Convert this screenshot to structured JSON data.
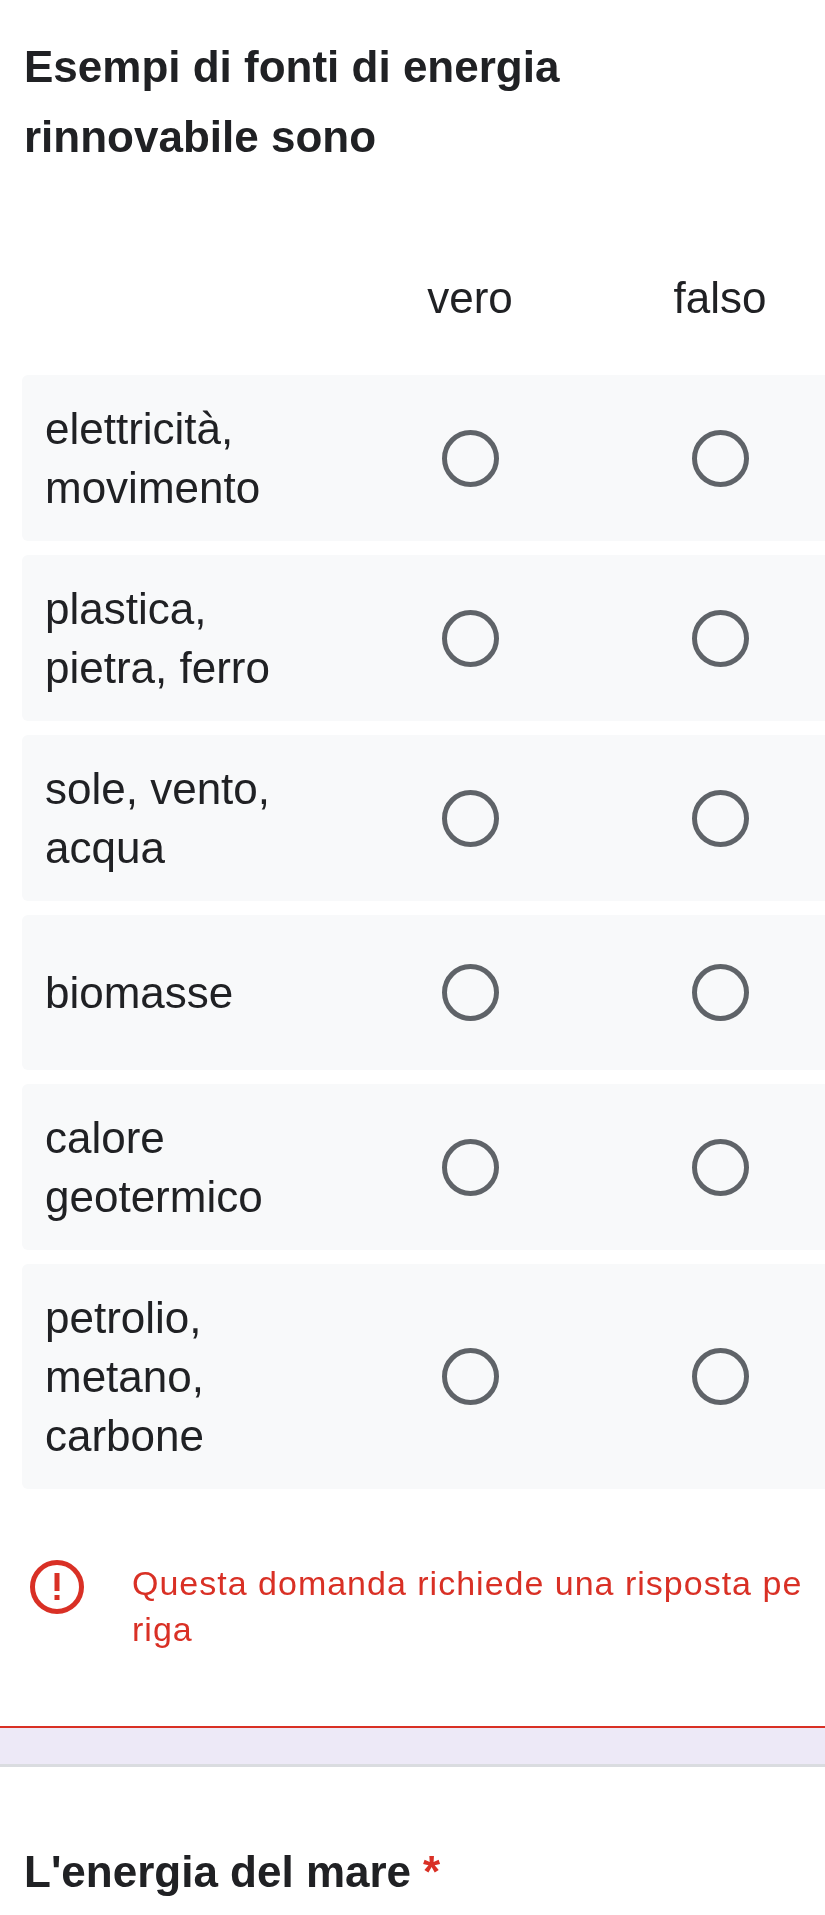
{
  "question": {
    "title": "Esempi di fonti di energia rinnovabile sono",
    "columns": [
      "vero",
      "falso"
    ],
    "rows": [
      {
        "label": "elettricità, movimento",
        "choices": [
          {
            "selected": false
          },
          {
            "selected": false
          }
        ]
      },
      {
        "label": "plastica, pietra, ferro",
        "choices": [
          {
            "selected": false
          },
          {
            "selected": false
          }
        ]
      },
      {
        "label": "sole, vento, acqua",
        "choices": [
          {
            "selected": false
          },
          {
            "selected": false
          }
        ]
      },
      {
        "label": "biomasse",
        "choices": [
          {
            "selected": false
          },
          {
            "selected": false
          }
        ]
      },
      {
        "label": "calore geotermico",
        "choices": [
          {
            "selected": false
          },
          {
            "selected": false
          }
        ]
      },
      {
        "label": "petrolio, metano, carbone",
        "choices": [
          {
            "selected": false
          },
          {
            "selected": false
          }
        ]
      }
    ],
    "error": {
      "message": "Questa domanda richiede una risposta pe\nriga"
    }
  },
  "next_question": {
    "title": "L'energia del mare",
    "required_mark": "*"
  }
}
